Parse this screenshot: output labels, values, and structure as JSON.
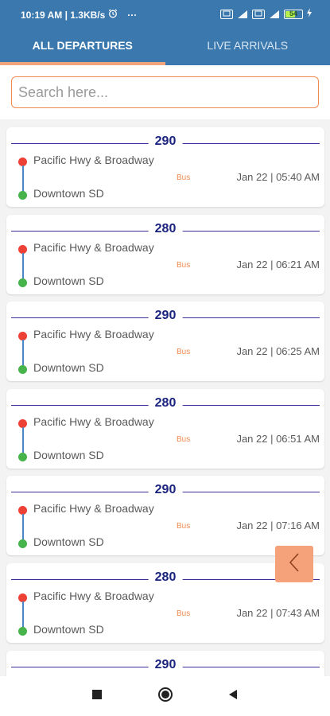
{
  "status_bar": {
    "time_speed": "10:19 AM | 1.3KB/s",
    "dots": "···",
    "battery": "54"
  },
  "tabs": [
    {
      "label": "ALL DEPARTURES",
      "active": true
    },
    {
      "label": "LIVE ARRIVALS",
      "active": false
    }
  ],
  "search": {
    "placeholder": "Search here...",
    "value": ""
  },
  "departures": [
    {
      "route": "290",
      "from": "Pacific Hwy & Broadway",
      "to": "Downtown SD",
      "mode": "Bus",
      "datetime": "Jan 22 | 05:40 AM"
    },
    {
      "route": "280",
      "from": "Pacific Hwy & Broadway",
      "to": "Downtown SD",
      "mode": "Bus",
      "datetime": "Jan 22 | 06:21 AM"
    },
    {
      "route": "290",
      "from": "Pacific Hwy & Broadway",
      "to": "Downtown SD",
      "mode": "Bus",
      "datetime": "Jan 22 | 06:25 AM"
    },
    {
      "route": "280",
      "from": "Pacific Hwy & Broadway",
      "to": "Downtown SD",
      "mode": "Bus",
      "datetime": "Jan 22 | 06:51 AM"
    },
    {
      "route": "290",
      "from": "Pacific Hwy & Broadway",
      "to": "Downtown SD",
      "mode": "Bus",
      "datetime": "Jan 22 | 07:16 AM"
    },
    {
      "route": "280",
      "from": "Pacific Hwy & Broadway",
      "to": "Downtown SD",
      "mode": "Bus",
      "datetime": "Jan 22 | 07:43 AM"
    },
    {
      "route": "290",
      "from": "",
      "to": "",
      "mode": "",
      "datetime": ""
    }
  ],
  "colors": {
    "header": "#3a78ad",
    "accent": "#f08a50",
    "route_text": "#1a237e",
    "origin_dot": "#ee4136",
    "destination_dot": "#46b34b"
  },
  "icons": {
    "alarm": "alarm-icon",
    "back_float": "chevron-left-icon",
    "nav_recent": "square-icon",
    "nav_home": "circle-icon",
    "nav_back": "triangle-left-icon"
  }
}
